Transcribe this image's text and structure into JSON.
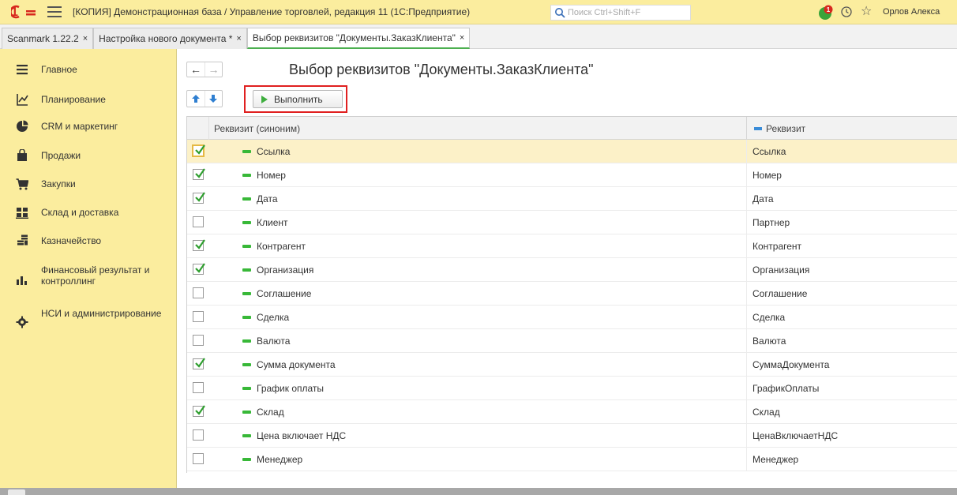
{
  "topbar": {
    "app_title": "[КОПИЯ] Демонстрационная база / Управление торговлей, редакция 11  (1С:Предприятие)",
    "search_placeholder": "Поиск Ctrl+Shift+F",
    "user_name": "Орлов Алекса",
    "notification_count": "1",
    "icons": [
      "logo-1c-icon",
      "menu-icon",
      "search-icon",
      "notification-icon",
      "history-icon",
      "favorites-star-icon"
    ]
  },
  "tabs": [
    {
      "label": "Scanmark 1.22.2",
      "close": "×",
      "active": false
    },
    {
      "label": "Настройка нового документа *",
      "close": "×",
      "active": false
    },
    {
      "label": "Выбор реквизитов \"Документы.ЗаказКлиента\"",
      "close": "×",
      "active": true
    }
  ],
  "sidebar": {
    "items": [
      {
        "label": "Главное",
        "icon": "main-menu-icon"
      },
      {
        "label": "Планирование",
        "icon": "planning-icon"
      },
      {
        "label": "CRM и маркетинг",
        "icon": "crm-icon"
      },
      {
        "label": "Продажи",
        "icon": "sales-bag-icon"
      },
      {
        "label": "Закупки",
        "icon": "purchases-cart-icon"
      },
      {
        "label": "Склад и доставка",
        "icon": "warehouse-icon"
      },
      {
        "label": "Казначейство",
        "icon": "treasury-coins-icon"
      },
      {
        "label": "Финансовый результат и контроллинг",
        "icon": "finance-chart-icon"
      },
      {
        "label": "НСИ и администрирование",
        "icon": "admin-gear-icon"
      }
    ]
  },
  "form": {
    "title": "Выбор реквизитов \"Документы.ЗаказКлиента\"",
    "back_label": "←",
    "forward_label": "→",
    "execute_label": "Выполнить",
    "highlight_color": "#e02020",
    "columns": {
      "synonym": "Реквизит (синоним)",
      "attribute": "Реквизит"
    },
    "rows": [
      {
        "synonym": "Ссылка",
        "attribute": "Ссылка",
        "checked": true,
        "selected": true
      },
      {
        "synonym": "Номер",
        "attribute": "Номер",
        "checked": true,
        "selected": false
      },
      {
        "synonym": "Дата",
        "attribute": "Дата",
        "checked": true,
        "selected": false
      },
      {
        "synonym": "Клиент",
        "attribute": "Партнер",
        "checked": false,
        "selected": false
      },
      {
        "synonym": "Контрагент",
        "attribute": "Контрагент",
        "checked": true,
        "selected": false
      },
      {
        "synonym": "Организация",
        "attribute": "Организация",
        "checked": true,
        "selected": false
      },
      {
        "synonym": "Соглашение",
        "attribute": "Соглашение",
        "checked": false,
        "selected": false
      },
      {
        "synonym": "Сделка",
        "attribute": "Сделка",
        "checked": false,
        "selected": false
      },
      {
        "synonym": "Валюта",
        "attribute": "Валюта",
        "checked": false,
        "selected": false
      },
      {
        "synonym": "Сумма документа",
        "attribute": "СуммаДокумента",
        "checked": true,
        "selected": false
      },
      {
        "synonym": "График оплаты",
        "attribute": "ГрафикОплаты",
        "checked": false,
        "selected": false
      },
      {
        "synonym": "Склад",
        "attribute": "Склад",
        "checked": true,
        "selected": false
      },
      {
        "synonym": "Цена включает НДС",
        "attribute": "ЦенаВключаетНДС",
        "checked": false,
        "selected": false
      },
      {
        "synonym": "Менеджер",
        "attribute": "Менеджер",
        "checked": false,
        "selected": false
      }
    ]
  }
}
